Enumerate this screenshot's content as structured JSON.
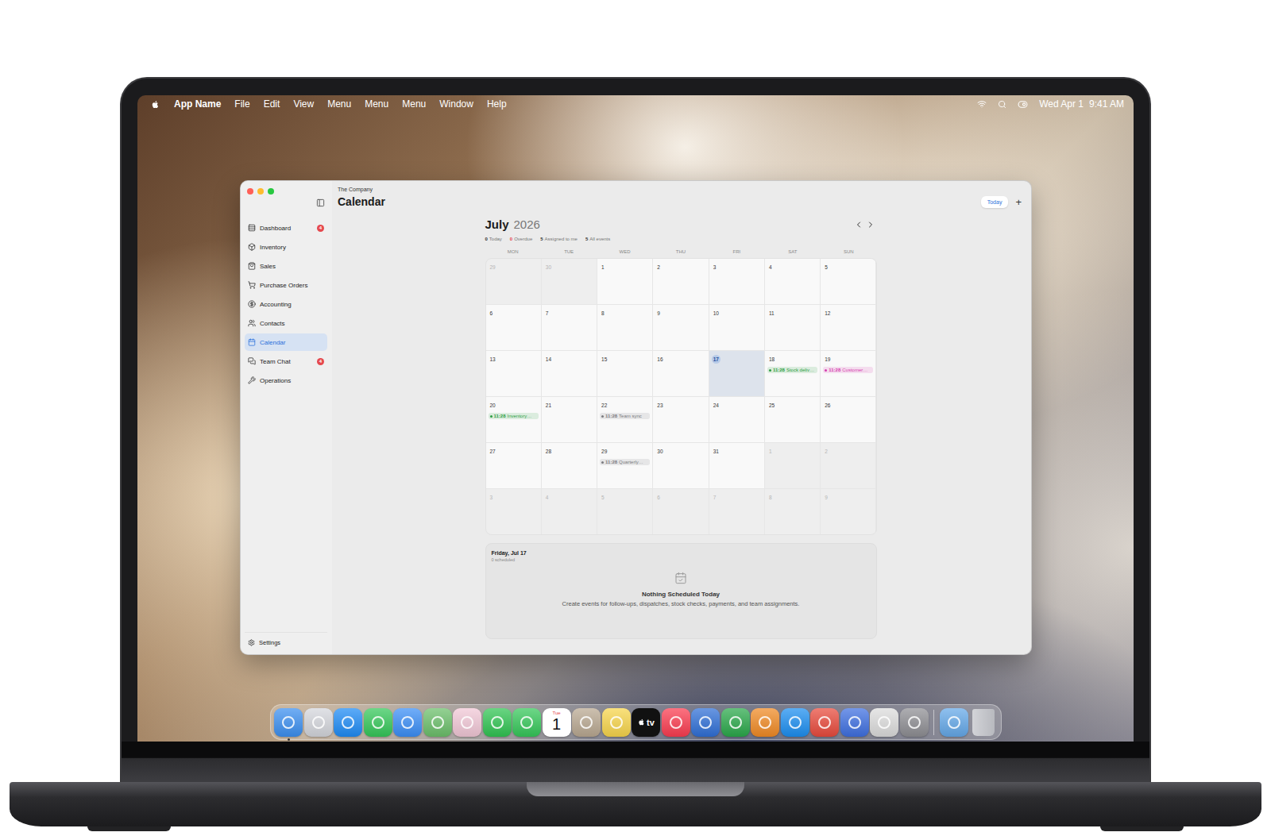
{
  "menubar": {
    "app": "App Name",
    "menus": [
      "File",
      "Edit",
      "View",
      "Menu",
      "Menu",
      "Menu",
      "Window",
      "Help"
    ],
    "date": "Wed Apr 1",
    "time": "9:41 AM"
  },
  "window": {
    "company": "The Company",
    "title": "Calendar",
    "today_button": "Today",
    "add_button": "+"
  },
  "sidebar": {
    "items": [
      {
        "label": "Dashboard",
        "selected": false,
        "badge": "4"
      },
      {
        "label": "Inventory",
        "selected": false,
        "badge": ""
      },
      {
        "label": "Sales",
        "selected": false,
        "badge": ""
      },
      {
        "label": "Purchase Orders",
        "selected": false,
        "badge": ""
      },
      {
        "label": "Accounting",
        "selected": false,
        "badge": ""
      },
      {
        "label": "Contacts",
        "selected": false,
        "badge": ""
      },
      {
        "label": "Calendar",
        "selected": true,
        "badge": ""
      },
      {
        "label": "Team Chat",
        "selected": false,
        "badge": "4"
      },
      {
        "label": "Operations",
        "selected": false,
        "badge": ""
      }
    ],
    "settings": "Settings"
  },
  "calendar": {
    "month": "July",
    "year": "2026",
    "stats": [
      {
        "value": "0",
        "label": "Today",
        "alert": false
      },
      {
        "value": "0",
        "label": "Overdue",
        "alert": true
      },
      {
        "value": "5",
        "label": "Assigned to me",
        "alert": false
      },
      {
        "value": "5",
        "label": "All events",
        "alert": false
      }
    ],
    "weekdays": [
      "MON",
      "TUE",
      "WED",
      "THU",
      "FRI",
      "SAT",
      "SUN"
    ],
    "weeks": [
      [
        {
          "day": "29",
          "in_month": false,
          "selected": false,
          "events": []
        },
        {
          "day": "30",
          "in_month": false,
          "selected": false,
          "events": []
        },
        {
          "day": "1",
          "in_month": true,
          "selected": false,
          "events": []
        },
        {
          "day": "2",
          "in_month": true,
          "selected": false,
          "events": []
        },
        {
          "day": "3",
          "in_month": true,
          "selected": false,
          "events": []
        },
        {
          "day": "4",
          "in_month": true,
          "selected": false,
          "events": []
        },
        {
          "day": "5",
          "in_month": true,
          "selected": false,
          "events": []
        }
      ],
      [
        {
          "day": "6",
          "in_month": true,
          "selected": false,
          "events": []
        },
        {
          "day": "7",
          "in_month": true,
          "selected": false,
          "events": []
        },
        {
          "day": "8",
          "in_month": true,
          "selected": false,
          "events": []
        },
        {
          "day": "9",
          "in_month": true,
          "selected": false,
          "events": []
        },
        {
          "day": "10",
          "in_month": true,
          "selected": false,
          "events": []
        },
        {
          "day": "11",
          "in_month": true,
          "selected": false,
          "events": []
        },
        {
          "day": "12",
          "in_month": true,
          "selected": false,
          "events": []
        }
      ],
      [
        {
          "day": "13",
          "in_month": true,
          "selected": false,
          "events": []
        },
        {
          "day": "14",
          "in_month": true,
          "selected": false,
          "events": []
        },
        {
          "day": "15",
          "in_month": true,
          "selected": false,
          "events": []
        },
        {
          "day": "16",
          "in_month": true,
          "selected": false,
          "events": []
        },
        {
          "day": "17",
          "in_month": true,
          "selected": true,
          "events": []
        },
        {
          "day": "18",
          "in_month": true,
          "selected": false,
          "events": [
            {
              "time": "11:28",
              "title": "Stock deliv…",
              "color": "#2f9e44"
            }
          ]
        },
        {
          "day": "19",
          "in_month": true,
          "selected": false,
          "events": [
            {
              "time": "11:28",
              "title": "Customer…",
              "color": "#d63fb0"
            }
          ]
        }
      ],
      [
        {
          "day": "20",
          "in_month": true,
          "selected": false,
          "events": [
            {
              "time": "11:28",
              "title": "Inventory…",
              "color": "#2f9e44"
            }
          ]
        },
        {
          "day": "21",
          "in_month": true,
          "selected": false,
          "events": []
        },
        {
          "day": "22",
          "in_month": true,
          "selected": false,
          "events": [
            {
              "time": "11:28",
              "title": "Team sync",
              "color": "#7c7c80"
            }
          ]
        },
        {
          "day": "23",
          "in_month": true,
          "selected": false,
          "events": []
        },
        {
          "day": "24",
          "in_month": true,
          "selected": false,
          "events": []
        },
        {
          "day": "25",
          "in_month": true,
          "selected": false,
          "events": []
        },
        {
          "day": "26",
          "in_month": true,
          "selected": false,
          "events": []
        }
      ],
      [
        {
          "day": "27",
          "in_month": true,
          "selected": false,
          "events": []
        },
        {
          "day": "28",
          "in_month": true,
          "selected": false,
          "events": []
        },
        {
          "day": "29",
          "in_month": true,
          "selected": false,
          "events": [
            {
              "time": "11:28",
              "title": "Quarterly…",
              "color": "#7c7c80"
            }
          ]
        },
        {
          "day": "30",
          "in_month": true,
          "selected": false,
          "events": []
        },
        {
          "day": "31",
          "in_month": true,
          "selected": false,
          "events": []
        },
        {
          "day": "1",
          "in_month": false,
          "selected": false,
          "events": []
        },
        {
          "day": "2",
          "in_month": false,
          "selected": false,
          "events": []
        }
      ],
      [
        {
          "day": "3",
          "in_month": false,
          "selected": false,
          "events": []
        },
        {
          "day": "4",
          "in_month": false,
          "selected": false,
          "events": []
        },
        {
          "day": "5",
          "in_month": false,
          "selected": false,
          "events": []
        },
        {
          "day": "6",
          "in_month": false,
          "selected": false,
          "events": []
        },
        {
          "day": "7",
          "in_month": false,
          "selected": false,
          "events": []
        },
        {
          "day": "8",
          "in_month": false,
          "selected": false,
          "events": []
        },
        {
          "day": "9",
          "in_month": false,
          "selected": false,
          "events": []
        }
      ]
    ]
  },
  "day_panel": {
    "date": "Friday, Jul 17",
    "count": "0 scheduled",
    "empty_title": "Nothing Scheduled Today",
    "empty_text": "Create events for follow-ups, dispatches, stock checks, payments, and team assignments."
  },
  "dock": [
    {
      "kind": "app",
      "color": "#3b8ff0",
      "running": true,
      "top": "",
      "label": ""
    },
    {
      "kind": "app",
      "color": "#d4d6dc",
      "running": false,
      "top": "",
      "label": ""
    },
    {
      "kind": "app",
      "color": "#1e8bf5",
      "running": false,
      "top": "",
      "label": ""
    },
    {
      "kind": "app",
      "color": "#34c759",
      "running": false,
      "top": "",
      "label": ""
    },
    {
      "kind": "app",
      "color": "#3a8ef6",
      "running": false,
      "top": "",
      "label": ""
    },
    {
      "kind": "app",
      "color": "#6bbf6a",
      "running": false,
      "top": "",
      "label": ""
    },
    {
      "kind": "app",
      "color": "#f1c7d6",
      "running": false,
      "top": "",
      "label": ""
    },
    {
      "kind": "app",
      "color": "#30c452",
      "running": false,
      "top": "",
      "label": ""
    },
    {
      "kind": "app",
      "color": "#35c759",
      "running": false,
      "top": "",
      "label": ""
    },
    {
      "kind": "calendar",
      "color": "#ffffff",
      "running": false,
      "top": "Tue",
      "label": "1"
    },
    {
      "kind": "app",
      "color": "#b9a891",
      "running": false,
      "top": "",
      "label": ""
    },
    {
      "kind": "app",
      "color": "#f7d54b",
      "running": false,
      "top": "",
      "label": ""
    },
    {
      "kind": "tv",
      "color": "#111111",
      "running": false,
      "top": "",
      "label": "tv"
    },
    {
      "kind": "app",
      "color": "#fa3c50",
      "running": false,
      "top": "",
      "label": ""
    },
    {
      "kind": "app",
      "color": "#2f6fd6",
      "running": false,
      "top": "",
      "label": ""
    },
    {
      "kind": "app",
      "color": "#2aa84a",
      "running": false,
      "top": "",
      "label": ""
    },
    {
      "kind": "app",
      "color": "#f08a24",
      "running": false,
      "top": "",
      "label": ""
    },
    {
      "kind": "app",
      "color": "#1c8ef0",
      "running": false,
      "top": "",
      "label": ""
    },
    {
      "kind": "app",
      "color": "#e84a3c",
      "running": false,
      "top": "",
      "label": ""
    },
    {
      "kind": "app",
      "color": "#3e6fe0",
      "running": false,
      "top": "",
      "label": ""
    },
    {
      "kind": "app",
      "color": "#dcdcdc",
      "running": false,
      "top": "",
      "label": ""
    },
    {
      "kind": "app",
      "color": "#8e8e93",
      "running": false,
      "top": "",
      "label": ""
    },
    {
      "kind": "separator",
      "color": "#ffffff",
      "running": false,
      "top": "",
      "label": ""
    },
    {
      "kind": "app",
      "color": "#64a8e8",
      "running": false,
      "top": "",
      "label": ""
    },
    {
      "kind": "trash",
      "color": "#c9cbd0",
      "running": false,
      "top": "",
      "label": ""
    }
  ]
}
